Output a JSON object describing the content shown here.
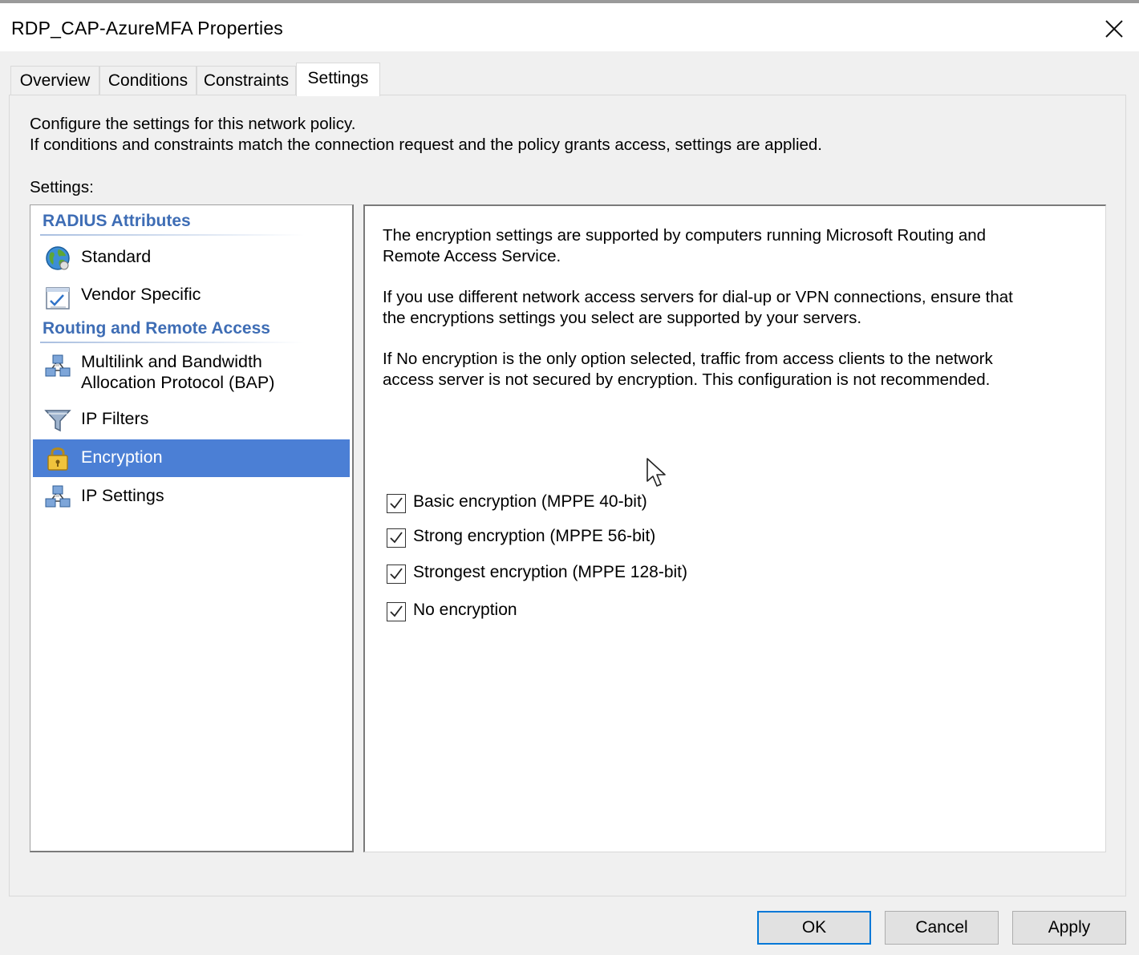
{
  "window": {
    "title": "RDP_CAP-AzureMFA Properties"
  },
  "tabs": [
    {
      "label": "Overview",
      "active": false
    },
    {
      "label": "Conditions",
      "active": false
    },
    {
      "label": "Constraints",
      "active": false
    },
    {
      "label": "Settings",
      "active": true
    }
  ],
  "intro": {
    "line1": "Configure the settings for this network policy.",
    "line2": "If conditions and constraints match the connection request and the policy grants access, settings are applied."
  },
  "settings_label": "Settings:",
  "tree": {
    "groups": [
      {
        "heading": "RADIUS Attributes",
        "items": [
          {
            "label": "Standard",
            "icon": "globe-icon"
          },
          {
            "label": "Vendor Specific",
            "icon": "checklist-icon"
          }
        ]
      },
      {
        "heading": "Routing and Remote Access",
        "items": [
          {
            "label_line1": "Multilink and Bandwidth",
            "label_line2": "Allocation Protocol (BAP)",
            "icon": "network-icon"
          },
          {
            "label": "IP Filters",
            "icon": "funnel-icon"
          },
          {
            "label": "Encryption",
            "icon": "padlock-icon",
            "selected": true
          },
          {
            "label": "IP Settings",
            "icon": "network-icon"
          }
        ]
      }
    ]
  },
  "description": {
    "para1_line1": "The encryption settings are supported by computers running Microsoft Routing and",
    "para1_line2": "Remote Access Service.",
    "para2_line1": "If you use different network access servers for dial-up or VPN connections, ensure that",
    "para2_line2": "the encryptions settings you select are supported by your servers.",
    "para3_line1": "If No encryption is the only option selected, traffic from access clients to the network",
    "para3_line2": "access server is not secured by encryption. This configuration is not recommended."
  },
  "options": [
    {
      "label": "Basic encryption (MPPE 40-bit)",
      "checked": true
    },
    {
      "label": "Strong encryption (MPPE 56-bit)",
      "checked": true
    },
    {
      "label": "Strongest encryption (MPPE 128-bit)",
      "checked": true
    },
    {
      "label": "No encryption",
      "checked": true
    }
  ],
  "buttons": {
    "ok": "OK",
    "cancel": "Cancel",
    "apply": "Apply"
  },
  "colors": {
    "accent": "#4b7fd5",
    "group_heading": "#3e6db5",
    "default_button_border": "#0078d7"
  }
}
